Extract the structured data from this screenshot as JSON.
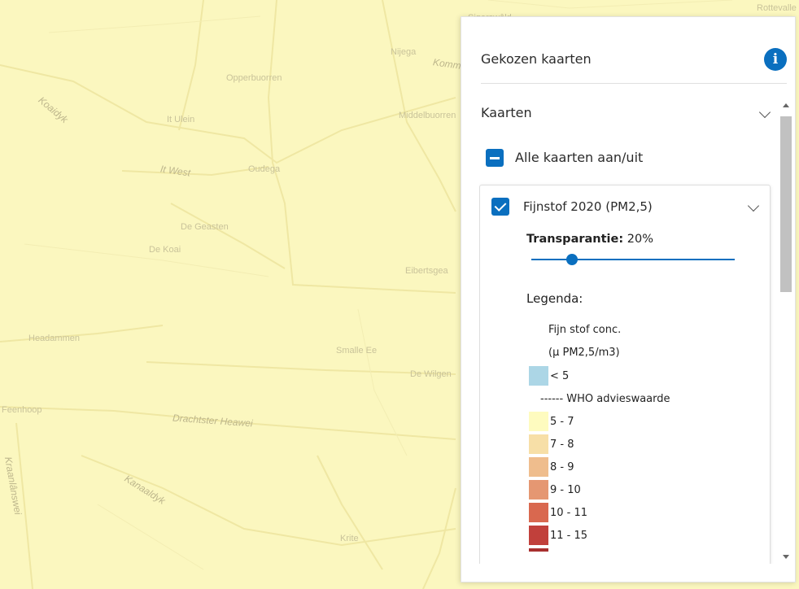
{
  "map": {
    "places": [
      {
        "name": "Sigerswâld"
      },
      {
        "name": "Rottevalle"
      },
      {
        "name": "Opperbuorren"
      },
      {
        "name": "It Ulein"
      },
      {
        "name": "Nijega"
      },
      {
        "name": "Middelbuorren"
      },
      {
        "name": "Oudega"
      },
      {
        "name": "De Geasten"
      },
      {
        "name": "De Koai"
      },
      {
        "name": "Eibertsgea"
      },
      {
        "name": "Headammen"
      },
      {
        "name": "Smalle Ee"
      },
      {
        "name": "De Wilgen"
      },
      {
        "name": "Feenhoop"
      },
      {
        "name": "Krite"
      }
    ],
    "roads": [
      {
        "name": "Koaidyk"
      },
      {
        "name": "It West"
      },
      {
        "name": "Drachtster Heawei"
      },
      {
        "name": "Kanaaldyk"
      },
      {
        "name": "Kraanlânswei"
      },
      {
        "name": "Komme"
      }
    ],
    "colors": {
      "background": "#fbf7bf",
      "roads": "#efe7a3",
      "labels": "#c9c39a"
    }
  },
  "panel": {
    "title": "Gekozen kaarten",
    "info_icon": "info-icon",
    "section_label": "Kaarten",
    "all_toggle_label": "Alle kaarten aan/uit",
    "layer": {
      "title": "Fijnstof 2020 (PM2,5)",
      "checked": true,
      "transparency_label": "Transparantie:",
      "transparency_value": "20%",
      "transparency_fraction": 0.2,
      "legend_title": "Legenda:",
      "legend_heading_1": "Fijn stof conc.",
      "legend_heading_2": "(µ PM2,5/m3)",
      "legend_items": [
        {
          "label": "< 5",
          "color": "#acd6e6"
        },
        {
          "label": "------ WHO advieswaarde",
          "color": null
        },
        {
          "label": "5 - 7",
          "color": "#fefbbf"
        },
        {
          "label": "7 - 8",
          "color": "#f7dfa7"
        },
        {
          "label": "8 - 9",
          "color": "#efbd8d"
        },
        {
          "label": "9 - 10",
          "color": "#e59772"
        },
        {
          "label": "10 - 11",
          "color": "#d9684f"
        },
        {
          "label": "11 - 15",
          "color": "#c1403b"
        }
      ]
    },
    "accent_color": "#0a6fbf"
  }
}
